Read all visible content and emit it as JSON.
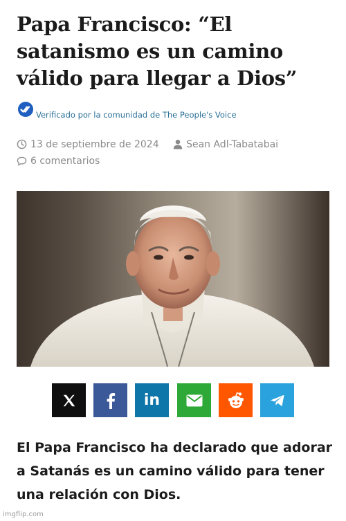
{
  "article": {
    "title": "Papa Francisco: “El satanismo es un camino válido para llegar a Dios”",
    "verified_text": "Verificado por la comunidad de The People's Voice",
    "date": "13 de septiembre de 2024",
    "author": "Sean Adl-Tabatabai",
    "comments": "6 comentarios",
    "lead": "El Papa Francisco ha declarado que adorar a Satanás es un camino válido para tener una relación con Dios."
  },
  "share": [
    {
      "network": "X",
      "icon": "x-icon",
      "color": "#0f0f0f"
    },
    {
      "network": "Facebook",
      "icon": "facebook-icon",
      "color": "#3b5998"
    },
    {
      "network": "LinkedIn",
      "icon": "linkedin-icon",
      "color": "#0e76a8"
    },
    {
      "network": "Email",
      "icon": "mail-icon",
      "color": "#2ea836"
    },
    {
      "network": "Reddit",
      "icon": "reddit-icon",
      "color": "#ff5700"
    },
    {
      "network": "Telegram",
      "icon": "telegram-icon",
      "color": "#2aa2dd"
    }
  ],
  "watermark": "imgflip.com"
}
